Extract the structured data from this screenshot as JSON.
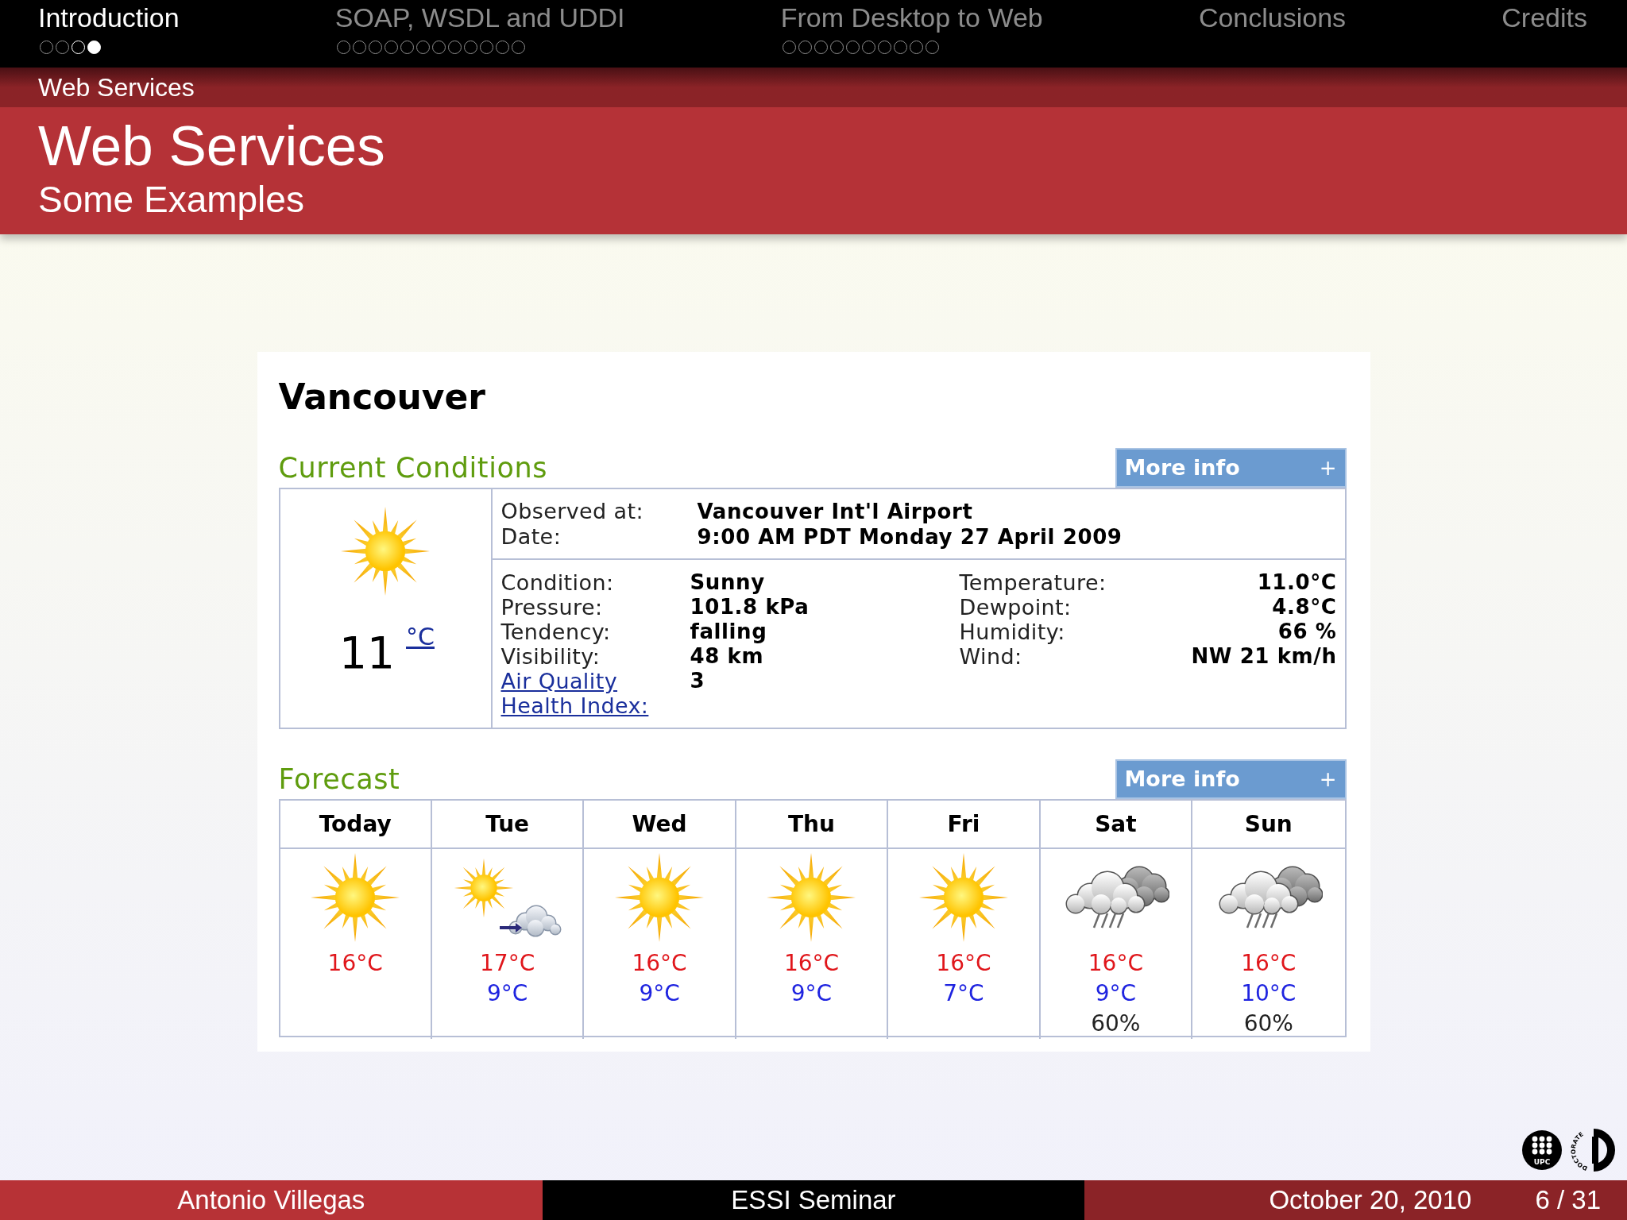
{
  "nav": [
    {
      "label": "Introduction",
      "selected": true,
      "dots": [
        {
          "selected": false,
          "highlighted": false
        },
        {
          "selected": false,
          "highlighted": false
        },
        {
          "selected": false,
          "highlighted": true
        },
        {
          "selected": true,
          "highlighted": true
        }
      ]
    },
    {
      "label": "SOAP, WSDL and UDDI",
      "selected": false,
      "dots": [
        {
          "selected": false,
          "highlighted": false
        },
        {
          "selected": false,
          "highlighted": false
        },
        {
          "selected": false,
          "highlighted": false
        },
        {
          "selected": false,
          "highlighted": false
        },
        {
          "selected": false,
          "highlighted": false
        },
        {
          "selected": false,
          "highlighted": false
        },
        {
          "selected": false,
          "highlighted": false
        },
        {
          "selected": false,
          "highlighted": false
        },
        {
          "selected": false,
          "highlighted": false
        },
        {
          "selected": false,
          "highlighted": false
        },
        {
          "selected": false,
          "highlighted": false
        },
        {
          "selected": false,
          "highlighted": false
        }
      ]
    },
    {
      "label": "From Desktop to Web",
      "selected": false,
      "dots": [
        {
          "selected": false,
          "highlighted": false
        },
        {
          "selected": false,
          "highlighted": false
        },
        {
          "selected": false,
          "highlighted": false
        },
        {
          "selected": false,
          "highlighted": false
        },
        {
          "selected": false,
          "highlighted": false
        },
        {
          "selected": false,
          "highlighted": false
        },
        {
          "selected": false,
          "highlighted": false
        },
        {
          "selected": false,
          "highlighted": false
        },
        {
          "selected": false,
          "highlighted": false
        },
        {
          "selected": false,
          "highlighted": false
        }
      ]
    },
    {
      "label": "Conclusions",
      "selected": false
    },
    {
      "label": "Credits",
      "selected": false
    }
  ],
  "subsection": "Web Services",
  "frame": {
    "title": "Web Services",
    "subtitle": "Some Examples"
  },
  "weather": {
    "city": "Vancouver",
    "current": {
      "heading": "Current Conditions",
      "more_info": {
        "label": "More info",
        "sign": "+"
      },
      "temperature": "11",
      "unit": "°C",
      "station": [
        {
          "label": "Observed at:",
          "value": "Vancouver Int'l Airport"
        },
        {
          "label": "Date:",
          "value": "9:00 AM PDT Monday 27 April 2009"
        }
      ],
      "details_left": [
        {
          "kind": "text",
          "label": "Condition:",
          "value": "Sunny"
        },
        {
          "kind": "text",
          "label": "Pressure:",
          "value": "101.8 kPa"
        },
        {
          "kind": "text",
          "label": "Tendency:",
          "value": "falling"
        },
        {
          "kind": "text",
          "label": "Visibility:",
          "value": "48 km"
        },
        {
          "kind": "link",
          "label": "Air Quality Health Index:",
          "value": "3"
        }
      ],
      "details_right": [
        {
          "label": "Temperature:",
          "value": "11.0°C"
        },
        {
          "label": "Dewpoint:",
          "value": "4.8°C"
        },
        {
          "label": "Humidity:",
          "value": "66 %"
        },
        {
          "label": "Wind:",
          "value": "NW 21 km/h"
        }
      ]
    },
    "forecast": {
      "heading": "Forecast",
      "more_info": {
        "label": "More info",
        "sign": "+"
      },
      "days": [
        {
          "day": "Today",
          "kind": "sunny",
          "high": "16°C"
        },
        {
          "day": "Tue",
          "kind": "sun-cloud",
          "high": "17°C",
          "low": "9°C"
        },
        {
          "day": "Wed",
          "kind": "sunny",
          "high": "16°C",
          "low": "9°C"
        },
        {
          "day": "Thu",
          "kind": "sunny",
          "high": "16°C",
          "low": "9°C"
        },
        {
          "day": "Fri",
          "kind": "sunny",
          "high": "16°C",
          "low": "7°C"
        },
        {
          "day": "Sat",
          "kind": "rain",
          "high": "16°C",
          "low": "9°C",
          "pop": "60%"
        },
        {
          "day": "Sun",
          "kind": "rain",
          "high": "16°C",
          "low": "10°C",
          "pop": "60%"
        }
      ]
    }
  },
  "logos": {
    "upc": "UPC",
    "doctorate": "DOCTORATE"
  },
  "footer": {
    "author": "Antonio Villegas",
    "event": "ESSI Seminar",
    "date": "October 20, 2010",
    "page": "6 / 31"
  }
}
